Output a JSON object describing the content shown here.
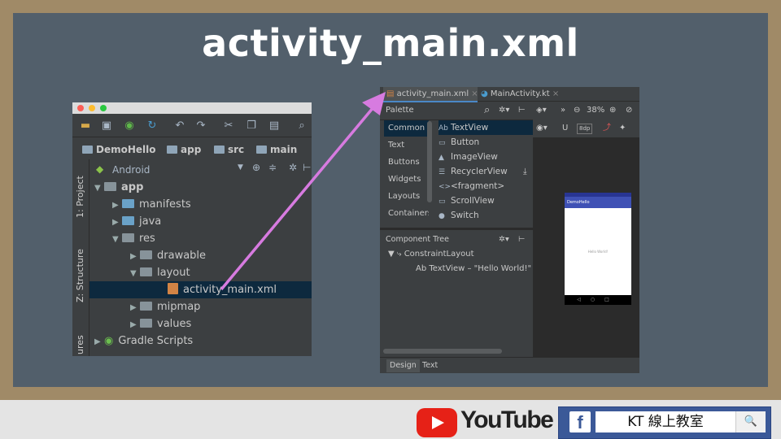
{
  "slide": {
    "title": "activity_main.xml"
  },
  "branding": {
    "youtube_text": "YouTube",
    "fb_f": "f",
    "fb_page": "KT 線上教室",
    "search_icon": "🔍"
  },
  "project_window": {
    "breadcrumbs": [
      "DemoHello",
      "app",
      "src",
      "main"
    ],
    "view_mode": "Android",
    "side_tabs": [
      "1: Project",
      "Z: Structure",
      "ures"
    ],
    "tree": [
      {
        "label": "app",
        "indent": 0,
        "arrow": "▼"
      },
      {
        "label": "manifests",
        "indent": 1,
        "arrow": "▶"
      },
      {
        "label": "java",
        "indent": 1,
        "arrow": "▶"
      },
      {
        "label": "res",
        "indent": 1,
        "arrow": "▼"
      },
      {
        "label": "drawable",
        "indent": 2,
        "arrow": "▶"
      },
      {
        "label": "layout",
        "indent": 2,
        "arrow": "▼"
      },
      {
        "label": "activity_main.xml",
        "indent": 3,
        "arrow": ""
      },
      {
        "label": "mipmap",
        "indent": 2,
        "arrow": "▶"
      },
      {
        "label": "values",
        "indent": 2,
        "arrow": "▶"
      },
      {
        "label": "Gradle Scripts",
        "indent": 0,
        "arrow": "▶"
      }
    ]
  },
  "editor_window": {
    "tabs": [
      "activity_main.xml",
      "MainActivity.kt"
    ],
    "palette_title": "Palette",
    "zoom": "38%",
    "margin": "8dp",
    "categories": [
      "Common",
      "Text",
      "Buttons",
      "Widgets",
      "Layouts",
      "Containers"
    ],
    "items": [
      {
        "icon": "Ab",
        "label": "TextView"
      },
      {
        "icon": "▭",
        "label": "Button"
      },
      {
        "icon": "▲",
        "label": "ImageView"
      },
      {
        "icon": "☰",
        "label": "RecyclerView"
      },
      {
        "icon": "<>",
        "label": "<fragment>"
      },
      {
        "icon": "▭",
        "label": "ScrollView"
      },
      {
        "icon": "●",
        "label": "Switch"
      }
    ],
    "component_tree_title": "Component Tree",
    "tree_root": "ConstraintLayout",
    "tree_child": "Ab TextView – \"Hello World!\"",
    "phone_app_name": "DemoHello",
    "phone_text": "Hello World!",
    "bottom_tabs": [
      "Design",
      "Text"
    ]
  }
}
